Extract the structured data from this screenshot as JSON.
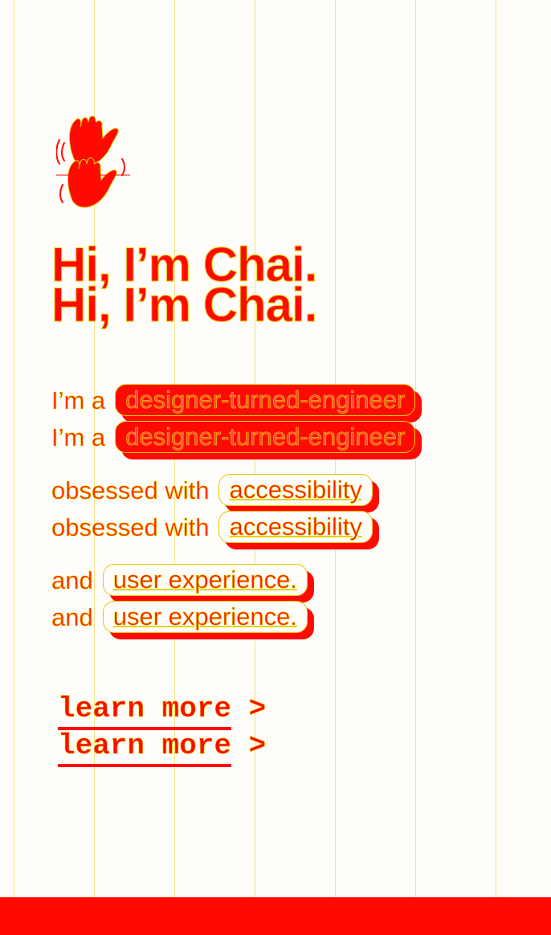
{
  "hero": {
    "logo_icon": "waving-hands-icon",
    "title": "Hi, I’m Chai."
  },
  "intro": {
    "line1_prefix": "I’m a",
    "line1_highlight": "designer-turned-engineer",
    "line2_prefix": "obsessed with",
    "line2_highlight": "accessibility",
    "line3_prefix": "and",
    "line3_highlight": "user experience."
  },
  "cta": {
    "label": "learn more",
    "chevron": ">"
  },
  "colors": {
    "accent": "#ff0a00",
    "guide": "#e8d400",
    "background": "#fffdfa"
  }
}
